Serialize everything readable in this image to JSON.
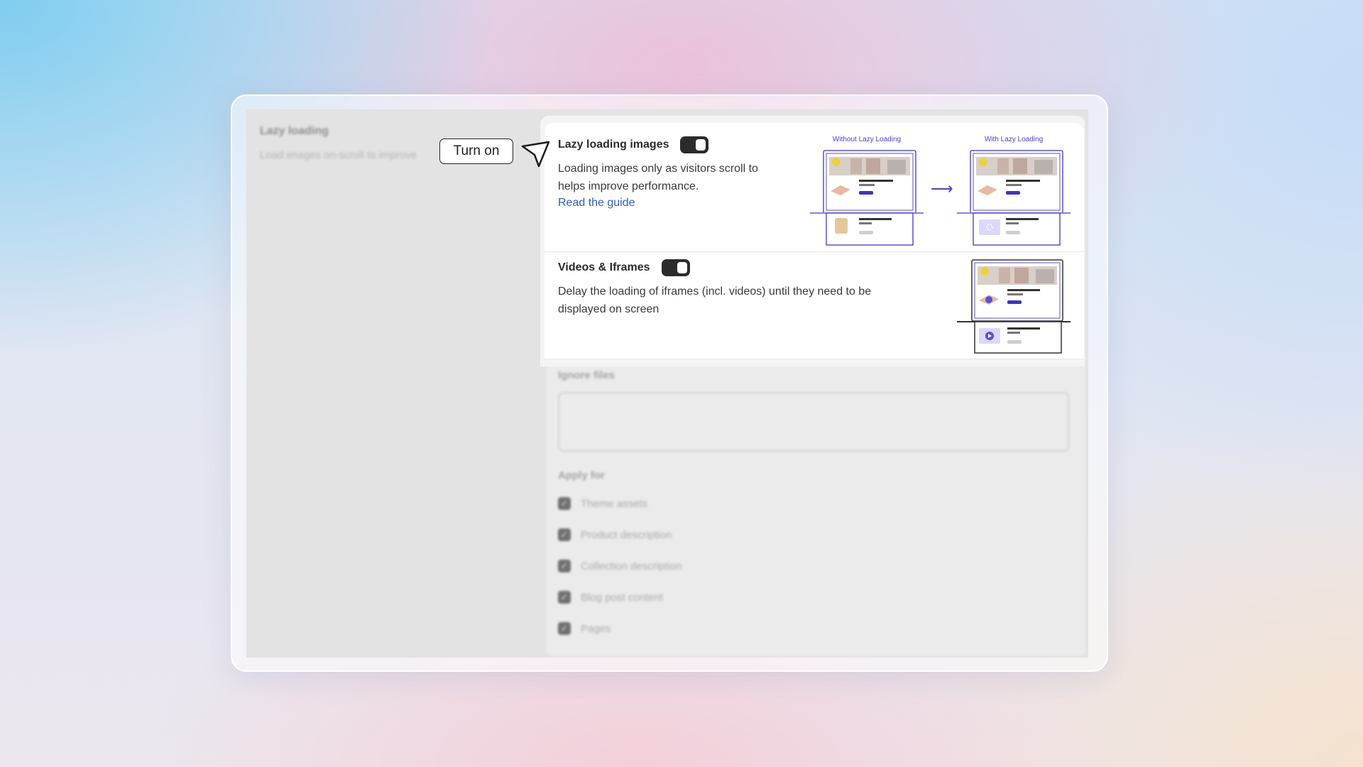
{
  "background_app": {
    "left_title": "Lazy loading",
    "left_desc": "Load images on-scroll to improve",
    "ignore_label": "Ignore files",
    "apply_label": "Apply for",
    "apply_items": [
      "Theme assets",
      "Product description",
      "Collection description",
      "Blog post content",
      "Pages"
    ]
  },
  "callout": {
    "label": "Turn on"
  },
  "lazy_images": {
    "title": "Lazy loading images",
    "enabled": true,
    "description_line1": "Loading images only as visitors scroll to",
    "description_line2": "helps improve performance.",
    "link": "Read the guide",
    "label_without": "Without Lazy Loading",
    "label_with": "With Lazy Loading"
  },
  "videos": {
    "title": "Videos & Iframes",
    "enabled": true,
    "description_line1": "Delay the loading of iframes (incl. videos) until they need to be",
    "description_line2": "displayed on screen"
  },
  "colors": {
    "accent": "#4b3fd1",
    "link": "#2d5bd0",
    "toggle_on": "#2b2b2b"
  }
}
